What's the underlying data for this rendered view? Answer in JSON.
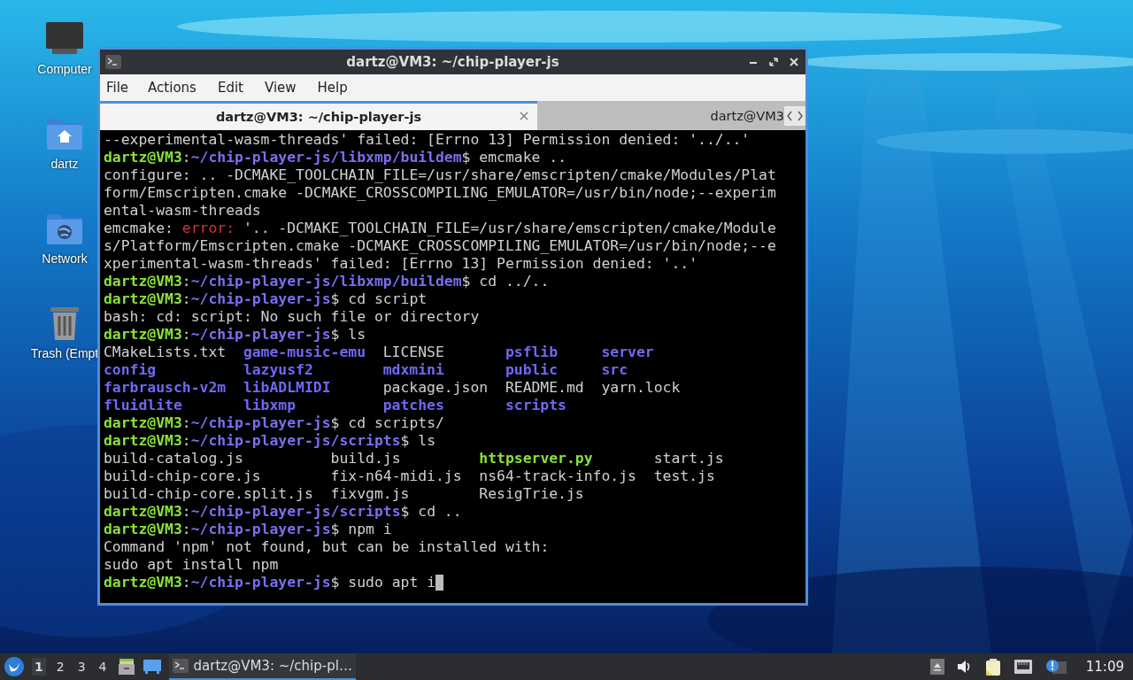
{
  "desktop_icons": [
    {
      "kind": "computer",
      "label": "Computer"
    },
    {
      "kind": "home",
      "label": "dartz"
    },
    {
      "kind": "network",
      "label": "Network"
    },
    {
      "kind": "trash",
      "label": "Trash (Empt"
    }
  ],
  "window": {
    "title": "dartz@VM3: ~/chip-player-js",
    "menu": [
      "File",
      "Actions",
      "Edit",
      "View",
      "Help"
    ],
    "tabs": [
      {
        "label": "dartz@VM3: ~/chip-player-js",
        "selected": true
      },
      {
        "label": "dartz@VM3",
        "selected": false
      }
    ],
    "terminal": {
      "cursor": true,
      "lines": [
        {
          "segments": [
            {
              "text": "--experimental-wasm-threads' failed: [Errno 13] Permission denied: '../..'",
              "kind": "plain"
            }
          ]
        },
        {
          "segments": [
            {
              "text": "dartz@VM3",
              "kind": "user"
            },
            {
              "text": ":",
              "kind": "plain"
            },
            {
              "text": "~/chip-player-js/libxmp/buildem",
              "kind": "path"
            },
            {
              "text": "$ emcmake ..",
              "kind": "plain"
            }
          ]
        },
        {
          "segments": [
            {
              "text": "configure: .. -DCMAKE_TOOLCHAIN_FILE=/usr/share/emscripten/cmake/Modules/Plat",
              "kind": "plain"
            }
          ]
        },
        {
          "segments": [
            {
              "text": "form/Emscripten.cmake -DCMAKE_CROSSCOMPILING_EMULATOR=/usr/bin/node;--experim",
              "kind": "plain"
            }
          ]
        },
        {
          "segments": [
            {
              "text": "ental-wasm-threads",
              "kind": "plain"
            }
          ]
        },
        {
          "segments": [
            {
              "text": "emcmake: ",
              "kind": "plain"
            },
            {
              "text": "error:",
              "kind": "error"
            },
            {
              "text": " '.. -DCMAKE_TOOLCHAIN_FILE=/usr/share/emscripten/cmake/Module",
              "kind": "plain"
            }
          ]
        },
        {
          "segments": [
            {
              "text": "s/Platform/Emscripten.cmake -DCMAKE_CROSSCOMPILING_EMULATOR=/usr/bin/node;--e",
              "kind": "plain"
            }
          ]
        },
        {
          "segments": [
            {
              "text": "xperimental-wasm-threads' failed: [Errno 13] Permission denied: '..'",
              "kind": "plain"
            }
          ]
        },
        {
          "segments": [
            {
              "text": "dartz@VM3",
              "kind": "user"
            },
            {
              "text": ":",
              "kind": "plain"
            },
            {
              "text": "~/chip-player-js/libxmp/buildem",
              "kind": "path"
            },
            {
              "text": "$ cd ../..",
              "kind": "plain"
            }
          ]
        },
        {
          "segments": [
            {
              "text": "dartz@VM3",
              "kind": "user"
            },
            {
              "text": ":",
              "kind": "plain"
            },
            {
              "text": "~/chip-player-js",
              "kind": "path"
            },
            {
              "text": "$ cd script",
              "kind": "plain"
            }
          ]
        },
        {
          "segments": [
            {
              "text": "bash: cd: script: No such file or directory",
              "kind": "plain"
            }
          ]
        },
        {
          "segments": [
            {
              "text": "dartz@VM3",
              "kind": "user"
            },
            {
              "text": ":",
              "kind": "plain"
            },
            {
              "text": "~/chip-player-js",
              "kind": "path"
            },
            {
              "text": "$ ls",
              "kind": "plain"
            }
          ]
        },
        {
          "kind": "ls",
          "cells": [
            {
              "text": "CMakeLists.txt",
              "kind": "plain"
            },
            {
              "text": "game-music-emu",
              "kind": "dir"
            },
            {
              "text": "LICENSE",
              "kind": "plain"
            },
            {
              "text": "psflib",
              "kind": "dir"
            },
            {
              "text": "server",
              "kind": "dir"
            }
          ]
        },
        {
          "kind": "ls",
          "cells": [
            {
              "text": "config",
              "kind": "dir"
            },
            {
              "text": "lazyusf2",
              "kind": "dir"
            },
            {
              "text": "mdxmini",
              "kind": "dir"
            },
            {
              "text": "public",
              "kind": "dir"
            },
            {
              "text": "src",
              "kind": "dir"
            }
          ]
        },
        {
          "kind": "ls",
          "cells": [
            {
              "text": "farbrausch-v2m",
              "kind": "dir"
            },
            {
              "text": "libADLMIDI",
              "kind": "dir"
            },
            {
              "text": "package.json",
              "kind": "plain"
            },
            {
              "text": "README.md",
              "kind": "plain"
            },
            {
              "text": "yarn.lock",
              "kind": "plain"
            }
          ]
        },
        {
          "kind": "ls",
          "cells": [
            {
              "text": "fluidlite",
              "kind": "dir"
            },
            {
              "text": "libxmp",
              "kind": "dir"
            },
            {
              "text": "patches",
              "kind": "dir"
            },
            {
              "text": "scripts",
              "kind": "dir"
            }
          ]
        },
        {
          "segments": [
            {
              "text": "dartz@VM3",
              "kind": "user"
            },
            {
              "text": ":",
              "kind": "plain"
            },
            {
              "text": "~/chip-player-js",
              "kind": "path"
            },
            {
              "text": "$ cd scripts/",
              "kind": "plain"
            }
          ]
        },
        {
          "segments": [
            {
              "text": "dartz@VM3",
              "kind": "user"
            },
            {
              "text": ":",
              "kind": "plain"
            },
            {
              "text": "~/chip-player-js/scripts",
              "kind": "path"
            },
            {
              "text": "$ ls",
              "kind": "plain"
            }
          ]
        },
        {
          "kind": "ls",
          "cells": [
            {
              "text": "build-catalog.js",
              "kind": "plain"
            },
            {
              "text": "build.js",
              "kind": "plain"
            },
            {
              "text": "httpserver.py",
              "kind": "exec"
            },
            {
              "text": "start.js",
              "kind": "plain"
            }
          ]
        },
        {
          "kind": "ls",
          "cells": [
            {
              "text": "build-chip-core.js",
              "kind": "plain"
            },
            {
              "text": "fix-n64-midi.js",
              "kind": "plain"
            },
            {
              "text": "ns64-track-info.js",
              "kind": "plain"
            },
            {
              "text": "test.js",
              "kind": "plain"
            }
          ]
        },
        {
          "kind": "ls",
          "cells": [
            {
              "text": "build-chip-core.split.js",
              "kind": "plain"
            },
            {
              "text": "fixvgm.js",
              "kind": "plain"
            },
            {
              "text": "ResigTrie.js",
              "kind": "plain"
            }
          ]
        },
        {
          "segments": [
            {
              "text": "dartz@VM3",
              "kind": "user"
            },
            {
              "text": ":",
              "kind": "plain"
            },
            {
              "text": "~/chip-player-js/scripts",
              "kind": "path"
            },
            {
              "text": "$ cd ..",
              "kind": "plain"
            }
          ]
        },
        {
          "segments": [
            {
              "text": "dartz@VM3",
              "kind": "user"
            },
            {
              "text": ":",
              "kind": "plain"
            },
            {
              "text": "~/chip-player-js",
              "kind": "path"
            },
            {
              "text": "$ npm i",
              "kind": "plain"
            }
          ]
        },
        {
          "segments": [
            {
              "text": "Command 'npm' not found, but can be installed with:",
              "kind": "plain"
            }
          ]
        },
        {
          "segments": [
            {
              "text": "sudo apt install npm",
              "kind": "plain"
            }
          ]
        },
        {
          "segments": [
            {
              "text": "dartz@VM3",
              "kind": "user"
            },
            {
              "text": ":",
              "kind": "plain"
            },
            {
              "text": "~/chip-player-js",
              "kind": "path"
            },
            {
              "text": "$ sudo apt i",
              "kind": "plain"
            }
          ]
        }
      ]
    }
  },
  "taskbar": {
    "workspaces": [
      {
        "label": "1",
        "selected": true
      },
      {
        "label": "2",
        "selected": false
      },
      {
        "label": "3",
        "selected": false
      },
      {
        "label": "4",
        "selected": false
      }
    ],
    "tasks": [
      {
        "label": "dartz@VM3: ~/chip-pl…",
        "selected": true
      }
    ],
    "clock": "11:09"
  }
}
